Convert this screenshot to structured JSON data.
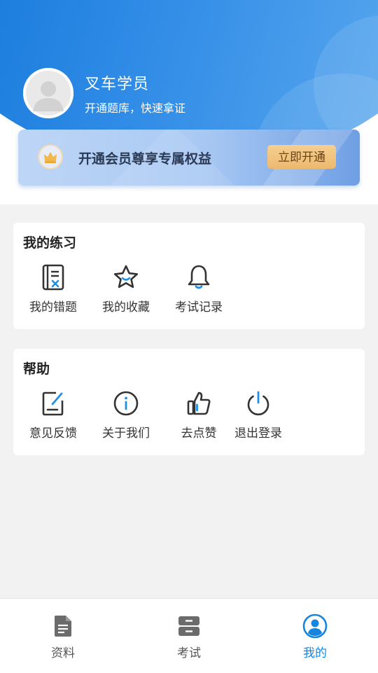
{
  "profile": {
    "name": "叉车学员",
    "subtitle": "开通题库，快速拿证"
  },
  "vip_banner": {
    "text": "开通会员尊享专属权益",
    "button_label": "立即开通"
  },
  "practice": {
    "title": "我的练习",
    "items": [
      {
        "label": "我的错题",
        "icon": "wrong-questions-icon"
      },
      {
        "label": "我的收藏",
        "icon": "star-favorites-icon"
      },
      {
        "label": "考试记录",
        "icon": "bell-records-icon"
      }
    ]
  },
  "help": {
    "title": "帮助",
    "items": [
      {
        "label": "意见反馈",
        "icon": "feedback-edit-icon"
      },
      {
        "label": "关于我们",
        "icon": "info-icon"
      },
      {
        "label": "去点赞",
        "icon": "thumbs-up-icon"
      },
      {
        "label": "退出登录",
        "icon": "power-icon"
      }
    ]
  },
  "tabbar": {
    "tabs": [
      {
        "label": "资料",
        "icon": "document-icon",
        "active": false
      },
      {
        "label": "考试",
        "icon": "exam-icon",
        "active": false
      },
      {
        "label": "我的",
        "icon": "profile-icon",
        "active": true
      }
    ]
  },
  "colors": {
    "brand_blue": "#1585e0",
    "icon_blue": "#1e90e8",
    "icon_dark": "#333333",
    "vip_button": "#f2c27e"
  }
}
